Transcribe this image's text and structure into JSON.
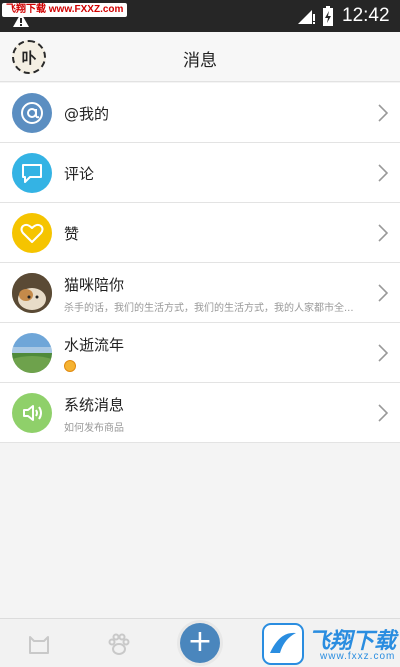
{
  "status_bar": {
    "watermark": "飞翔下载 www.FXXZ.com",
    "time": "12:42"
  },
  "header": {
    "avatar_text": "卟",
    "title": "消息"
  },
  "messages": [
    {
      "title": "@我的",
      "icon": "at-icon",
      "color": "#5b8ec1"
    },
    {
      "title": "评论",
      "icon": "comment-icon",
      "color": "#34b3e4"
    },
    {
      "title": "赞",
      "icon": "heart-icon",
      "color": "#f5c400"
    },
    {
      "title": "猫咪陪你",
      "subtitle": "杀手的话，我们的生活方式，我们的生活方式，我的人家都市全...",
      "icon": "cat-avatar"
    },
    {
      "title": "水逝流年",
      "subtitle": "",
      "icon": "landscape-avatar"
    },
    {
      "title": "系统消息",
      "subtitle": "如何发布商品",
      "icon": "speaker-icon",
      "color": "#8fd06a"
    }
  ],
  "bottom_bar": {
    "add_label": "+",
    "watermark_text": "飞翔下载",
    "watermark_url": "www.fxxz.com"
  }
}
